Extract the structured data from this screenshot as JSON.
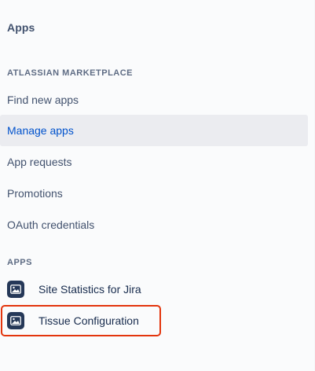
{
  "sidebar": {
    "title": "Apps",
    "marketplace_heading": "ATLASSIAN MARKETPLACE",
    "marketplace_items": [
      {
        "label": "Find new apps"
      },
      {
        "label": "Manage apps"
      },
      {
        "label": "App requests"
      },
      {
        "label": "Promotions"
      },
      {
        "label": "OAuth credentials"
      }
    ],
    "active_item": "Manage apps",
    "apps_heading": "APPS",
    "app_items": [
      {
        "label": "Site Statistics for Jira",
        "icon": "app-image-icon"
      },
      {
        "label": "Tissue Configuration",
        "icon": "app-image-icon"
      }
    ]
  },
  "colors": {
    "active_text": "#0052cc",
    "active_bg": "#ebecf0",
    "highlight_border": "#e3350d"
  }
}
